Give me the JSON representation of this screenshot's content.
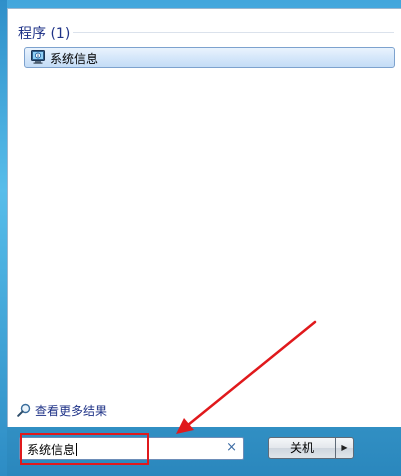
{
  "results": {
    "section_title": "程序 (1)",
    "items": [
      {
        "label": "系统信息",
        "icon": "system-info-icon"
      }
    ]
  },
  "see_more": {
    "label": "查看更多结果",
    "icon": "search-magnifier-icon"
  },
  "search": {
    "value": "系统信息",
    "clear_icon": "×"
  },
  "shutdown": {
    "label": "关机",
    "arrow": "▶"
  },
  "colors": {
    "accent_blue": "#1e3287",
    "highlight_border": "#7da2ce",
    "annotation_red": "#e0191c"
  }
}
